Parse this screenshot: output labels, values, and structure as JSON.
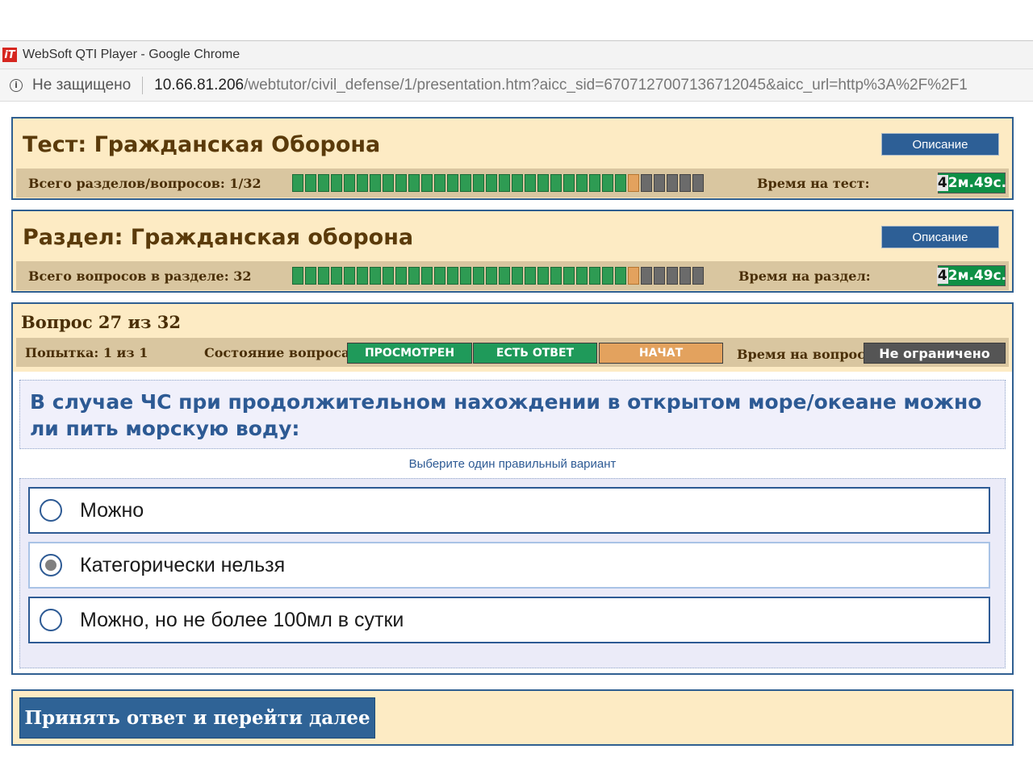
{
  "browser": {
    "app_icon": "websoft-logo-icon",
    "window_title": "WebSoft QTI Player - Google Chrome",
    "security_label": "Не защищено",
    "url_host": "10.66.81.206",
    "url_path": "/webtutor/civil_defense/1/presentation.htm?aicc_sid=6707127007136712045&aicc_url=http%3A%2F%2F1"
  },
  "test_panel": {
    "title": "Тест: Гражданская Оборона",
    "description_button": "Описание",
    "count_label": "Всего разделов/вопросов: 1/32",
    "time_label": "Время на тест:",
    "timer_highlight": "4",
    "timer_rest": "2м.49с.",
    "progress": {
      "total": 32,
      "completed": 26,
      "current": 27
    }
  },
  "section_panel": {
    "title": "Раздел: Гражданская оборона",
    "description_button": "Описание",
    "count_label": "Всего вопросов в разделе: 32",
    "time_label": "Время на раздел:",
    "timer_highlight": "4",
    "timer_rest": "2м.49с.",
    "progress": {
      "total": 32,
      "completed": 26,
      "current": 27
    }
  },
  "question_panel": {
    "title": "Вопрос 27 из 32",
    "attempt_label": "Попытка: 1 из 1",
    "state_label": "Состояние вопроса:",
    "states": [
      "ПРОСМОТРЕН",
      "ЕСТЬ ОТВЕТ",
      "НАЧАТ"
    ],
    "state_colors": [
      "#1f9a5a",
      "#1f9a5a",
      "#e3a25e"
    ],
    "time_label": "Время на вопрос:",
    "time_value": "Не ограничено",
    "question_text": "В случае ЧС при продолжительном нахождении в открытом море/океане можно ли пить морскую воду:",
    "hint": "Выберите один правильный вариант",
    "answers": [
      {
        "text": "Можно",
        "selected": false
      },
      {
        "text": "Категорически нельзя",
        "selected": true
      },
      {
        "text": "Можно, но не более 100мл в сутки",
        "selected": false
      }
    ]
  },
  "submit_button": "Принять ответ и перейти далее"
}
